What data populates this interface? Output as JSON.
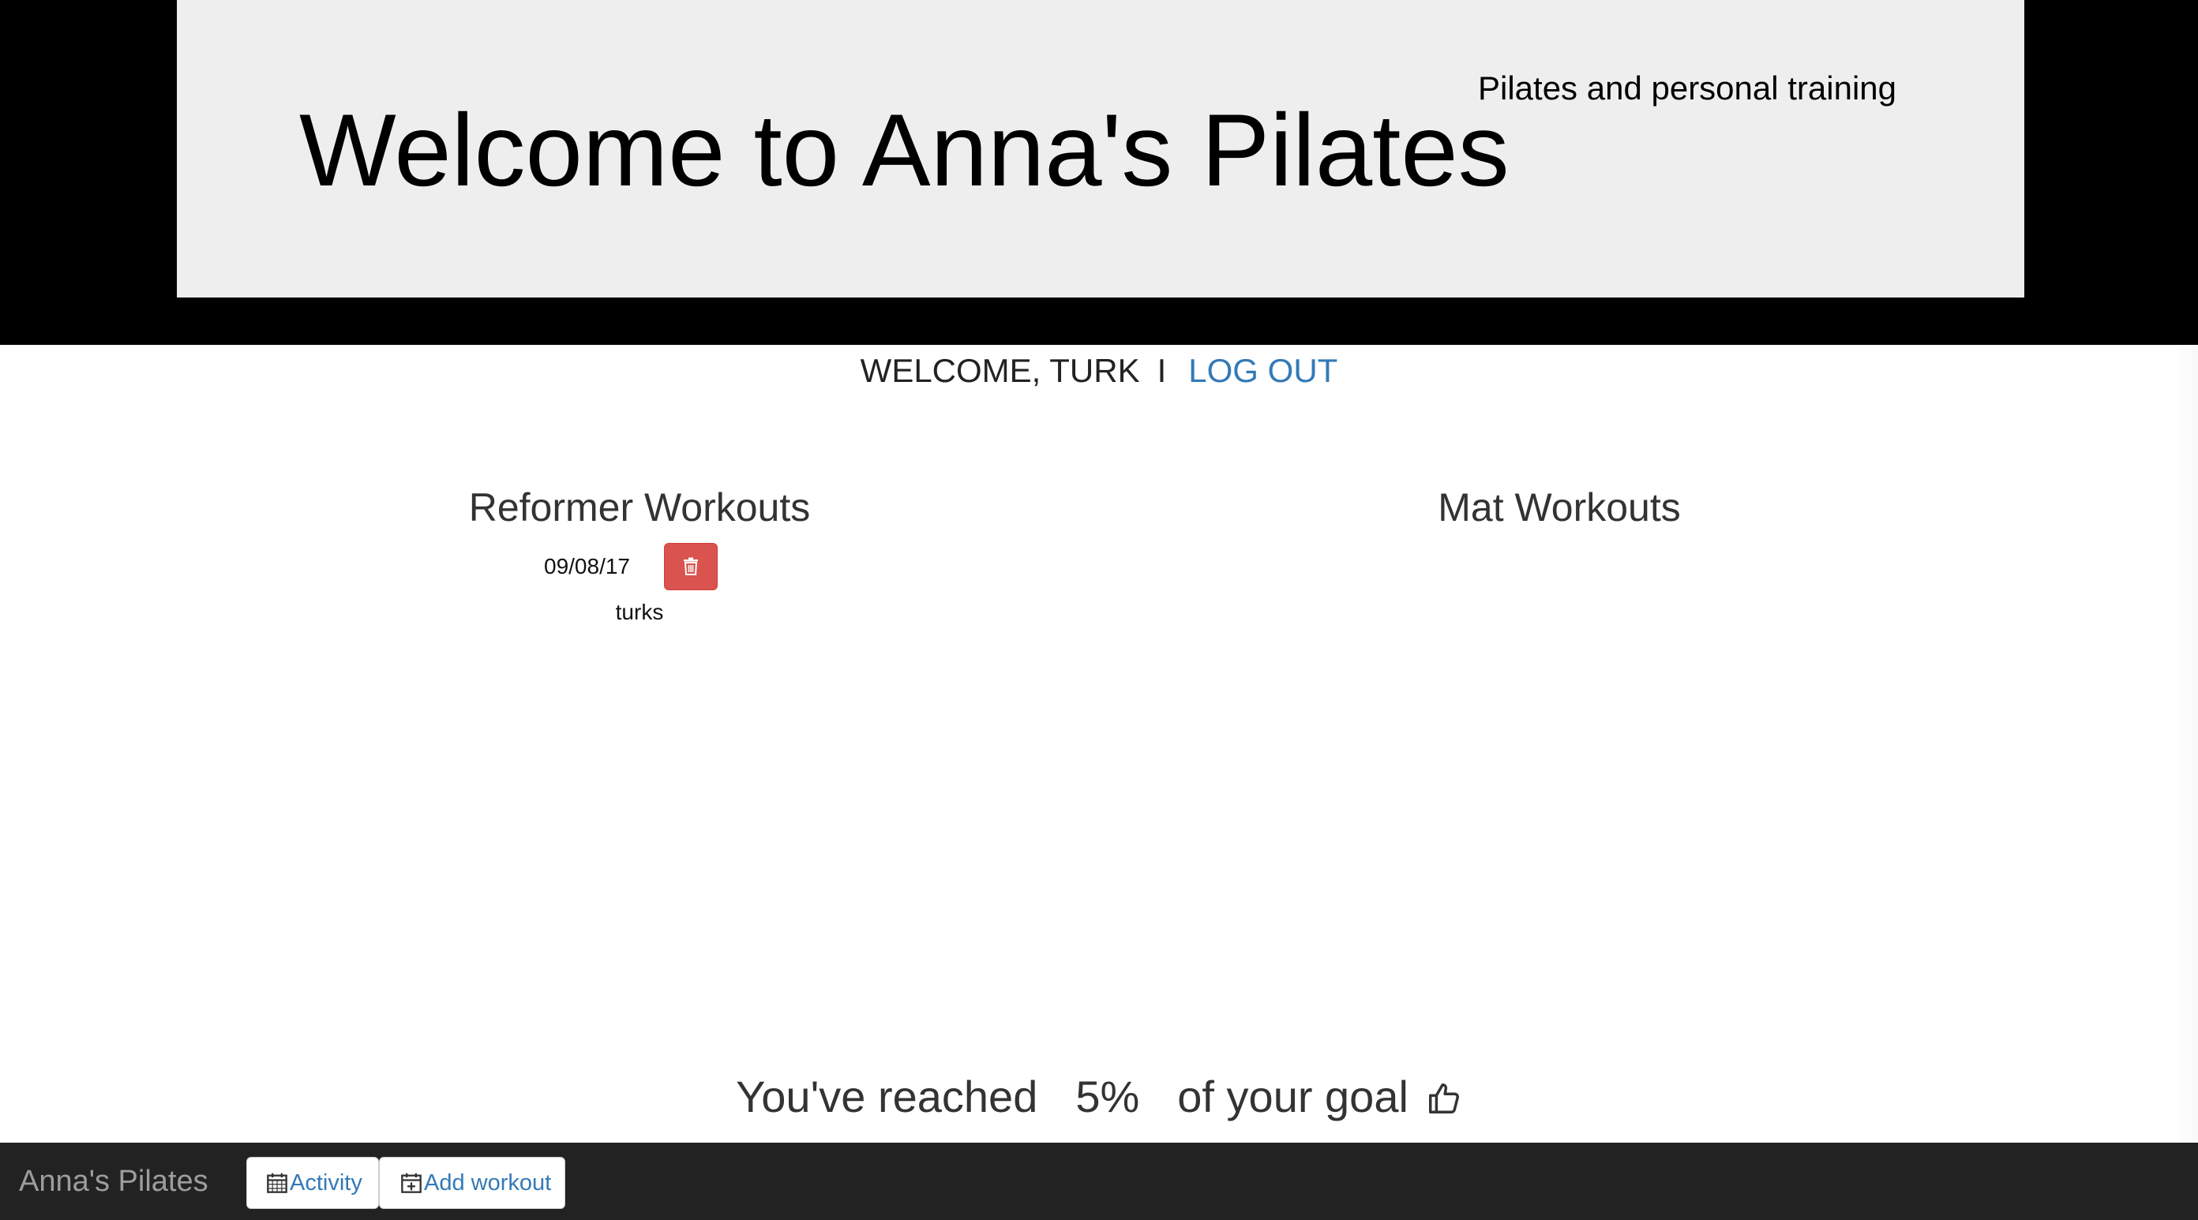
{
  "header": {
    "title": "Welcome to Anna's Pilates",
    "tagline": "Pilates and personal training"
  },
  "welcome_bar": {
    "greeting": "WELCOME, TURK",
    "separator": "I",
    "logout_label": "LOG OUT"
  },
  "reformer": {
    "title": "Reformer Workouts",
    "entries": [
      {
        "date": "09/08/17",
        "note": "turks",
        "delete_icon": "trash-icon"
      }
    ]
  },
  "mat": {
    "title": "Mat Workouts",
    "entries": []
  },
  "goal": {
    "prefix": "You've reached",
    "percent": "5%",
    "suffix": "of your goal",
    "icon": "thumbs-up-icon"
  },
  "navbar": {
    "brand": "Anna's Pilates",
    "activity_label": "Activity",
    "activity_icon": "calendar-icon",
    "add_workout_label": "Add workout",
    "add_workout_icon": "calendar-plus-icon"
  },
  "colors": {
    "header_bg": "#eeeeee",
    "page_band": "#000000",
    "link": "#337ab7",
    "danger": "#d9534f",
    "navbar_bg": "#222222",
    "navbar_brand": "#9d9d9d"
  }
}
